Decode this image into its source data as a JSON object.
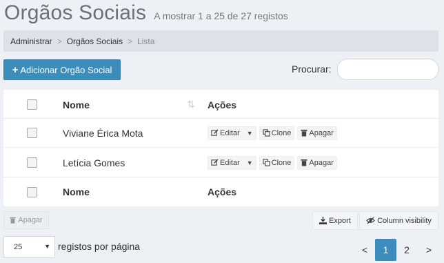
{
  "header": {
    "title": "Orgãos Sociais",
    "subtitle": "A mostrar 1 a 25 de 27 registos"
  },
  "breadcrumb": [
    "Administrar",
    "Orgãos Sociais",
    "Lista"
  ],
  "toolbar": {
    "add_label": "Adicionar Orgão Social",
    "search_label": "Procurar:",
    "search_value": ""
  },
  "table": {
    "columns": [
      "Nome",
      "Ações"
    ],
    "rows": [
      {
        "nome": "Viviane Érica Mota"
      },
      {
        "nome": "Letícia Gomes"
      }
    ],
    "actions": {
      "edit": "Editar",
      "clone": "Clone",
      "delete": "Apagar"
    }
  },
  "bulk": {
    "delete_label": "Apagar"
  },
  "buttons": {
    "export": "Export",
    "column_visibility": "Column visibility"
  },
  "pagination": {
    "per_page": "25",
    "per_page_label": "registos por página",
    "prev": "<",
    "pages": [
      "1",
      "2"
    ],
    "next": ">"
  },
  "colors": {
    "primary": "#3c8dbc",
    "background": "#edf0f4",
    "breadcrumb_bg": "#dde1e8"
  }
}
